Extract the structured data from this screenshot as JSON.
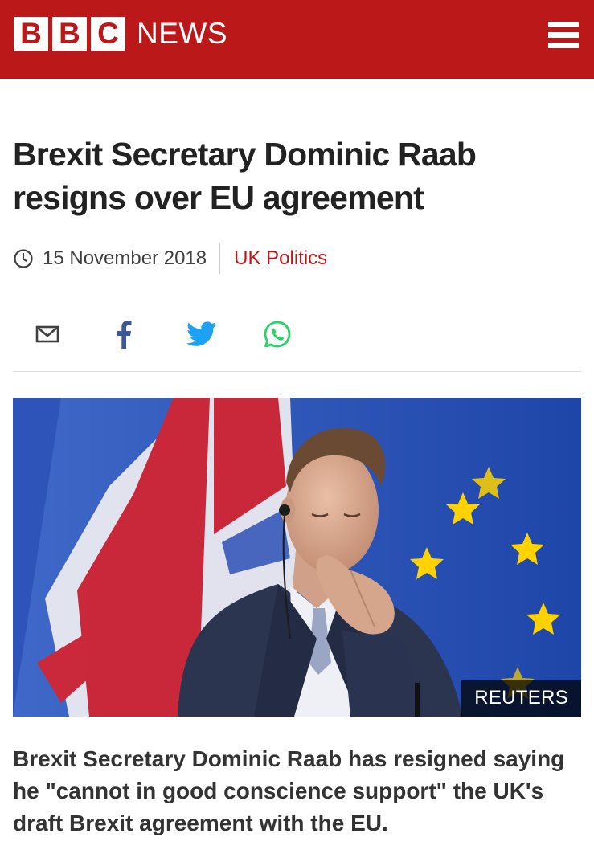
{
  "header": {
    "logo_letters": [
      "B",
      "B",
      "C"
    ],
    "logo_text": "NEWS",
    "menu_icon": "hamburger-menu-icon",
    "brand_color": "#bb1919"
  },
  "article": {
    "headline": "Brexit Secretary Dominic Raab resigns over EU agreement",
    "date": "15 November 2018",
    "topic": "UK Politics",
    "intro": "Brexit Secretary Dominic Raab has resigned saying he \"cannot in good conscience support\" the UK's draft Brexit agreement with the EU."
  },
  "share": {
    "items": [
      {
        "icon": "email-icon"
      },
      {
        "icon": "facebook-icon",
        "color": "#3b5998"
      },
      {
        "icon": "twitter-icon",
        "color": "#1da1f2"
      },
      {
        "icon": "whatsapp-icon",
        "color": "#25d366"
      }
    ]
  },
  "image": {
    "credit": "REUTERS"
  }
}
